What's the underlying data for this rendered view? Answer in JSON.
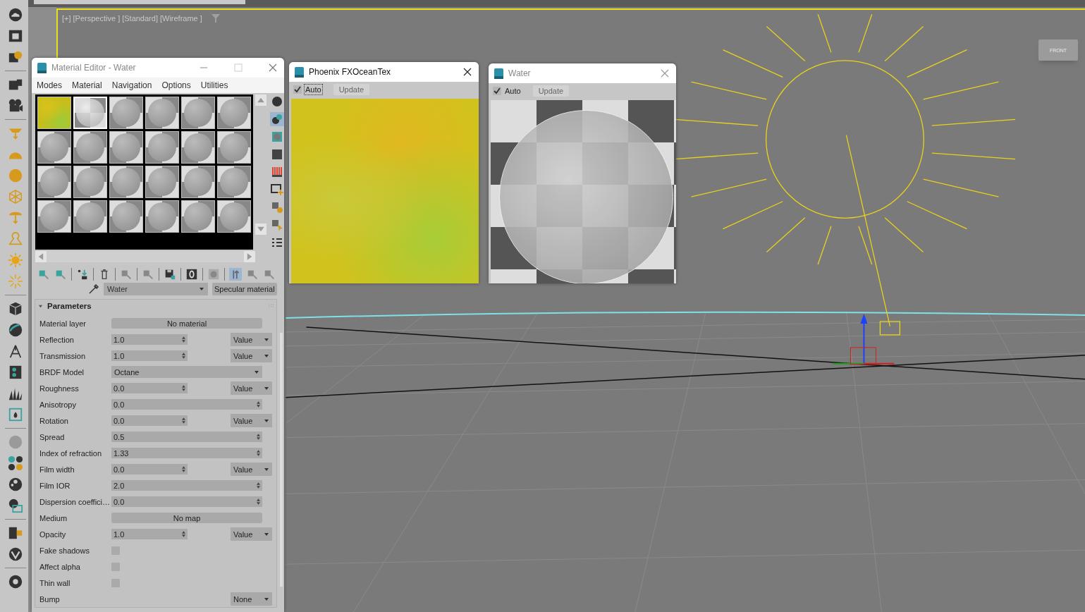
{
  "viewport": {
    "labels": [
      "[+]",
      "[Perspective ]",
      "[Standard]",
      "[Wireframe ]"
    ],
    "viewcube_face": "FRONT",
    "active": true
  },
  "material_editor": {
    "title": "Material Editor - Water",
    "menus": [
      {
        "label": "Modes"
      },
      {
        "label": "Material"
      },
      {
        "label": "Navigation"
      },
      {
        "label": "Options"
      },
      {
        "label": "Utilities"
      }
    ],
    "slots": [
      {
        "kind": "texture",
        "selected": false
      },
      {
        "kind": "checker-sphere",
        "selected": true
      },
      {
        "kind": "sphere",
        "selected": false
      },
      {
        "kind": "sphere",
        "selected": false
      },
      {
        "kind": "sphere",
        "selected": false
      },
      {
        "kind": "sphere",
        "selected": false
      },
      {
        "kind": "sphere",
        "selected": false
      },
      {
        "kind": "sphere",
        "selected": false
      },
      {
        "kind": "sphere",
        "selected": false
      },
      {
        "kind": "sphere",
        "selected": false
      },
      {
        "kind": "sphere",
        "selected": false
      },
      {
        "kind": "sphere",
        "selected": false
      },
      {
        "kind": "sphere",
        "selected": false
      },
      {
        "kind": "sphere",
        "selected": false
      },
      {
        "kind": "sphere",
        "selected": false
      },
      {
        "kind": "sphere",
        "selected": false
      },
      {
        "kind": "sphere",
        "selected": false
      },
      {
        "kind": "sphere",
        "selected": false
      },
      {
        "kind": "sphere",
        "selected": false
      },
      {
        "kind": "sphere",
        "selected": false
      },
      {
        "kind": "sphere",
        "selected": false
      },
      {
        "kind": "sphere",
        "selected": false
      },
      {
        "kind": "sphere",
        "selected": false
      },
      {
        "kind": "sphere",
        "selected": false
      }
    ],
    "material_name": "Water",
    "material_type": "Specular material",
    "rollout": {
      "title": "Parameters",
      "expanded": true,
      "rows": [
        {
          "kind": "button",
          "label": "Material layer",
          "value": "No material"
        },
        {
          "kind": "spinner-map",
          "label": "Reflection",
          "value": "1.0",
          "map": "Value"
        },
        {
          "kind": "spinner-map",
          "label": "Transmission",
          "value": "1.0",
          "map": "Value"
        },
        {
          "kind": "dropdown",
          "label": "BRDF Model",
          "value": "Octane"
        },
        {
          "kind": "spinner-map",
          "label": "Roughness",
          "value": "0.0",
          "map": "Value"
        },
        {
          "kind": "spinner",
          "label": "Anisotropy",
          "value": "0.0"
        },
        {
          "kind": "spinner-map",
          "label": "Rotation",
          "value": "0.0",
          "map": "Value"
        },
        {
          "kind": "spinner",
          "label": "Spread",
          "value": "0.5"
        },
        {
          "kind": "spinner",
          "label": "Index of refraction",
          "value": "1.33"
        },
        {
          "kind": "spinner-map",
          "label": "Film width",
          "value": "0.0",
          "map": "Value"
        },
        {
          "kind": "spinner",
          "label": "Film IOR",
          "value": "2.0"
        },
        {
          "kind": "spinner",
          "label": "Dispersion coeffici…",
          "value": "0.0"
        },
        {
          "kind": "button",
          "label": "Medium",
          "value": "No map"
        },
        {
          "kind": "spinner-map",
          "label": "Opacity",
          "value": "1.0",
          "map": "Value"
        },
        {
          "kind": "checkbox",
          "label": "Fake shadows",
          "checked": false
        },
        {
          "kind": "checkbox",
          "label": "Affect alpha",
          "checked": false
        },
        {
          "kind": "checkbox",
          "label": "Thin wall",
          "checked": false
        },
        {
          "kind": "map",
          "label": "Bump",
          "map": "None"
        }
      ]
    }
  },
  "preview_windows": [
    {
      "title": "Phoenix FXOceanTex",
      "active": true,
      "auto_label": "Auto",
      "auto_checked": true,
      "update_label": "Update",
      "update_disabled": true,
      "kind": "texture"
    },
    {
      "title": "Water",
      "active": false,
      "auto_label": "Auto",
      "auto_checked": true,
      "update_label": "Update",
      "update_disabled": true,
      "kind": "render"
    }
  ]
}
